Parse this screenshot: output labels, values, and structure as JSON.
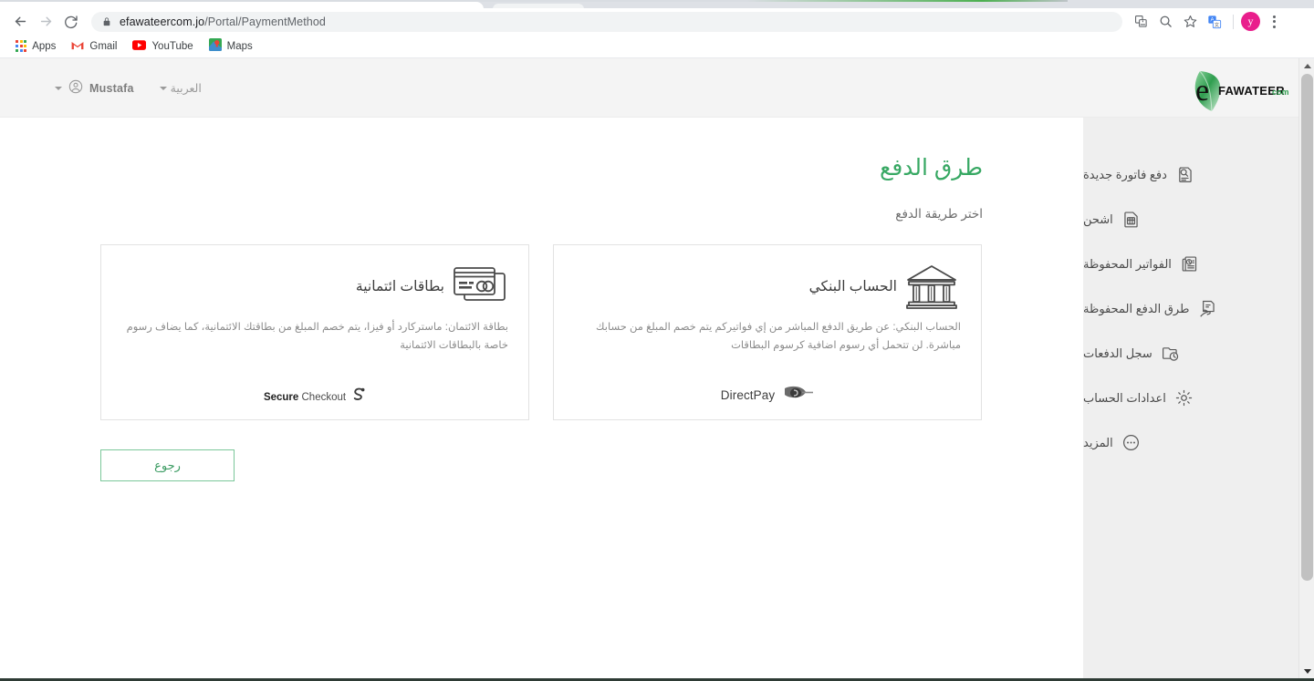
{
  "browser": {
    "back_label": "Back",
    "forward_label": "Forward",
    "reload_label": "Reload",
    "url_host": "efawateercom.jo",
    "url_path": "/Portal/PaymentMethod",
    "lock_icon": "lock-icon",
    "toolbar_icons": [
      "translate-page-icon",
      "search-icon",
      "bookmark-star-icon",
      "google-translate-extension-icon"
    ],
    "profile_initial": "y",
    "menu_icon": "three-dot-menu-icon",
    "bookmarks": [
      {
        "label": "Apps",
        "icon": "apps-grid-icon"
      },
      {
        "label": "Gmail",
        "icon": "gmail-icon"
      },
      {
        "label": "YouTube",
        "icon": "youtube-icon"
      },
      {
        "label": "Maps",
        "icon": "google-maps-icon"
      }
    ]
  },
  "header": {
    "user_name": "Mustafa",
    "user_icon": "user-circle-icon",
    "language": "العربية",
    "brand": {
      "name_mark": "e",
      "name_main": "FAWATEER",
      "name_suffix": "com",
      "icon": "efawateercom-logo"
    }
  },
  "sidebar": {
    "items": [
      {
        "label": "دفع فاتورة جديدة",
        "icon": "new-bill-payment-icon"
      },
      {
        "label": "اشحن",
        "icon": "sim-recharge-icon"
      },
      {
        "label": "الفواتير المحفوظة",
        "icon": "saved-bills-icon"
      },
      {
        "label": "طرق الدفع المحفوظة",
        "icon": "saved-payment-methods-icon"
      },
      {
        "label": "سجل الدفعات",
        "icon": "payment-history-icon"
      },
      {
        "label": "اعدادات الحساب",
        "icon": "account-settings-gear-icon"
      },
      {
        "label": "المزيد",
        "icon": "more-ellipsis-icon"
      }
    ]
  },
  "main": {
    "title": "طرق الدفع",
    "subtitle": "اختر طريقة الدفع",
    "cards": [
      {
        "id": "bank-account",
        "title": "الحساب البنكي",
        "icon": "bank-building-icon",
        "description": "الحساب البنكي: عن طريق الدفع المباشر من إي فواتيركم يتم خصم المبلغ من حسابك مباشرة. لن تتحمل أي رسوم اضافية كرسوم البطاقات",
        "logo_text": "DirectPay",
        "logo_icon": "directpay-logo-icon"
      },
      {
        "id": "credit-cards",
        "title": "بطاقات ائتمانية",
        "icon": "credit-cards-icon",
        "description": "بطاقة الائتمان: ماستركارد أو فيزا، يتم خصم المبلغ من بطاقتك الائتمانية، كما يضاف رسوم خاصة بالبطاقات الائتمانية",
        "logo_text_bold": "Secure",
        "logo_text_rest": " Checkout",
        "logo_icon": "secure-checkout-logo-icon"
      }
    ],
    "back_button": "رجوع"
  },
  "colors": {
    "brand_green": "#37a863",
    "button_green_border": "#7bc79a",
    "button_green_text": "#3c9c63",
    "sidebar_bg": "#efefef",
    "header_bg": "#f4f4f4",
    "avatar_pink": "#e91e8c"
  }
}
